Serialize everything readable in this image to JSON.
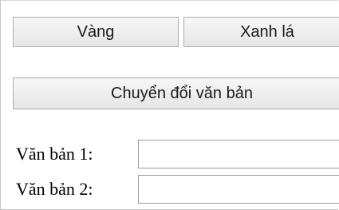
{
  "buttons": {
    "yellow_label": "Vàng",
    "green_label": "Xanh lá",
    "convert_label": "Chuyển đổi văn bản"
  },
  "fields": {
    "text1_label": "Văn bản 1:",
    "text1_value": "",
    "text2_label": "Văn bản 2:",
    "text2_value": ""
  }
}
